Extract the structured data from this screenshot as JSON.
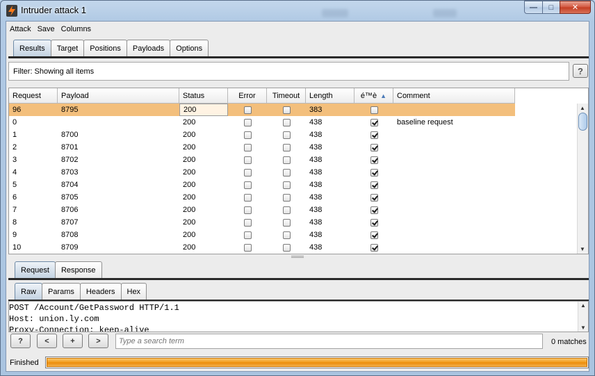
{
  "window": {
    "title": "Intruder attack 1",
    "controls": {
      "minimize": "—",
      "maximize": "□",
      "close": "✕"
    }
  },
  "menu": [
    "Attack",
    "Save",
    "Columns"
  ],
  "main_tabs": [
    "Results",
    "Target",
    "Positions",
    "Payloads",
    "Options"
  ],
  "filter": {
    "text": "Filter:  Showing all items",
    "help": "?"
  },
  "table": {
    "columns": [
      "Request",
      "Payload",
      "Status",
      "Error",
      "Timeout",
      "Length",
      "é™è",
      "Comment"
    ],
    "sorted_column": "é™è",
    "sort_direction": "ascending",
    "rows": [
      {
        "request": "96",
        "payload": "8795",
        "status": "200",
        "error": false,
        "timeout": false,
        "length": "383",
        "flag": false,
        "comment": "",
        "selected": true
      },
      {
        "request": "0",
        "payload": "",
        "status": "200",
        "error": false,
        "timeout": false,
        "length": "438",
        "flag": true,
        "comment": "baseline request",
        "selected": false
      },
      {
        "request": "1",
        "payload": "8700",
        "status": "200",
        "error": false,
        "timeout": false,
        "length": "438",
        "flag": true,
        "comment": "",
        "selected": false
      },
      {
        "request": "2",
        "payload": "8701",
        "status": "200",
        "error": false,
        "timeout": false,
        "length": "438",
        "flag": true,
        "comment": "",
        "selected": false
      },
      {
        "request": "3",
        "payload": "8702",
        "status": "200",
        "error": false,
        "timeout": false,
        "length": "438",
        "flag": true,
        "comment": "",
        "selected": false
      },
      {
        "request": "4",
        "payload": "8703",
        "status": "200",
        "error": false,
        "timeout": false,
        "length": "438",
        "flag": true,
        "comment": "",
        "selected": false
      },
      {
        "request": "5",
        "payload": "8704",
        "status": "200",
        "error": false,
        "timeout": false,
        "length": "438",
        "flag": true,
        "comment": "",
        "selected": false
      },
      {
        "request": "6",
        "payload": "8705",
        "status": "200",
        "error": false,
        "timeout": false,
        "length": "438",
        "flag": true,
        "comment": "",
        "selected": false
      },
      {
        "request": "7",
        "payload": "8706",
        "status": "200",
        "error": false,
        "timeout": false,
        "length": "438",
        "flag": true,
        "comment": "",
        "selected": false
      },
      {
        "request": "8",
        "payload": "8707",
        "status": "200",
        "error": false,
        "timeout": false,
        "length": "438",
        "flag": true,
        "comment": "",
        "selected": false
      },
      {
        "request": "9",
        "payload": "8708",
        "status": "200",
        "error": false,
        "timeout": false,
        "length": "438",
        "flag": true,
        "comment": "",
        "selected": false
      },
      {
        "request": "10",
        "payload": "8709",
        "status": "200",
        "error": false,
        "timeout": false,
        "length": "438",
        "flag": true,
        "comment": "",
        "selected": false
      }
    ]
  },
  "detail_tabs": [
    "Request",
    "Response"
  ],
  "view_tabs": [
    "Raw",
    "Params",
    "Headers",
    "Hex"
  ],
  "editor_lines": [
    "POST /Account/GetPassword HTTP/1.1",
    "Host: union.ly.com",
    "Proxy-Connection: keep-alive"
  ],
  "search": {
    "help": "?",
    "prev": "<",
    "add": "+",
    "next": ">",
    "placeholder": "Type a search term",
    "matches": "0 matches"
  },
  "status": {
    "text": "Finished",
    "progress": 1.0
  },
  "colors": {
    "selected_row": "#f3bf7c",
    "progress": "#f29a18",
    "active_tab": "#c4d3e2"
  }
}
